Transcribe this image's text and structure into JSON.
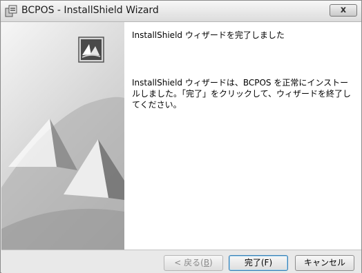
{
  "window": {
    "title": "BCPOS - InstallShield Wizard",
    "close_label": "x"
  },
  "content": {
    "heading": "InstallShield ウィザードを完了しました",
    "message": "InstallShield ウィザードは、BCPOS を正常にインストールしました。「完了」をクリックして、ウィザードを終了してください。"
  },
  "footer": {
    "back_prefix": "< 戻る(",
    "back_mnemonic": "B",
    "back_suffix": ")",
    "finish_label": "完了(F)",
    "cancel_label": "キャンセル"
  }
}
